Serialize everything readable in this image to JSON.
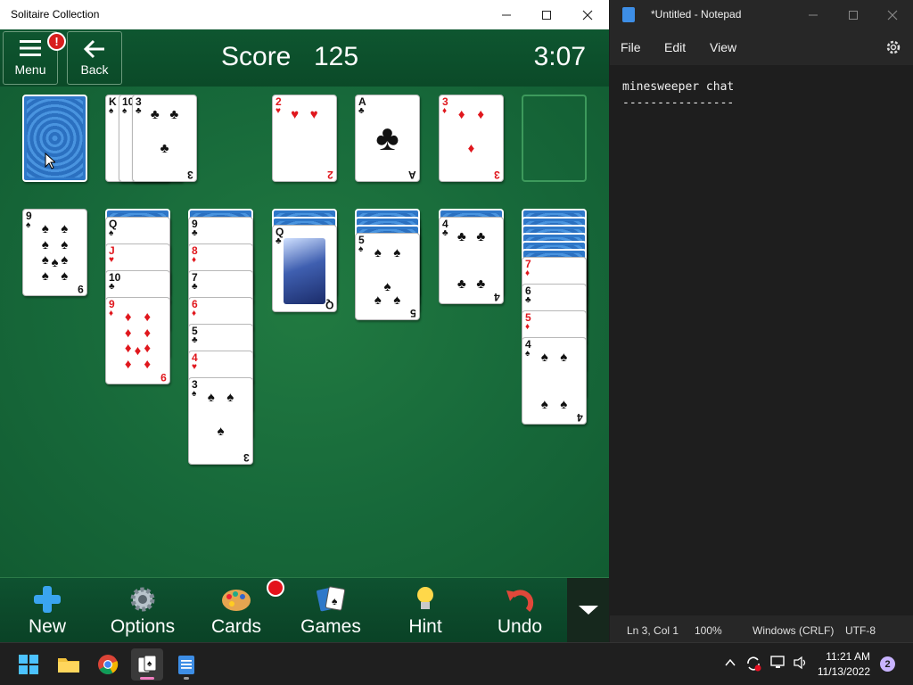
{
  "solitaire": {
    "title": "Solitaire Collection",
    "menu_label": "Menu",
    "menu_alert": "!",
    "back_label": "Back",
    "score_label": "Score",
    "score_value": "125",
    "timer": "3:07",
    "toolbar": {
      "new": "New",
      "options": "Options",
      "cards": "Cards",
      "games": "Games",
      "hint": "Hint",
      "undo": "Undo"
    },
    "waste": [
      {
        "rank": "K",
        "suit": "♠",
        "color": "black"
      },
      {
        "rank": "10",
        "suit": "♠",
        "color": "black"
      },
      {
        "rank": "3",
        "suit": "♣",
        "color": "black"
      }
    ],
    "foundations": [
      {
        "rank": "2",
        "suit": "♥",
        "color": "red"
      },
      {
        "rank": "A",
        "suit": "♣",
        "color": "black"
      },
      {
        "rank": "3",
        "suit": "♦",
        "color": "red"
      },
      null
    ],
    "tableau": [
      {
        "hidden": 0,
        "cards": [
          {
            "rank": "9",
            "suit": "♠",
            "color": "black"
          }
        ]
      },
      {
        "hidden": 1,
        "cards": [
          {
            "rank": "Q",
            "suit": "♠",
            "color": "black",
            "face": true
          },
          {
            "rank": "J",
            "suit": "♥",
            "color": "red",
            "face": true
          },
          {
            "rank": "10",
            "suit": "♣",
            "color": "black"
          },
          {
            "rank": "9",
            "suit": "♦",
            "color": "red"
          }
        ]
      },
      {
        "hidden": 1,
        "cards": [
          {
            "rank": "9",
            "suit": "♣",
            "color": "black"
          },
          {
            "rank": "8",
            "suit": "♦",
            "color": "red"
          },
          {
            "rank": "7",
            "suit": "♣",
            "color": "black"
          },
          {
            "rank": "6",
            "suit": "♦",
            "color": "red"
          },
          {
            "rank": "5",
            "suit": "♣",
            "color": "black"
          },
          {
            "rank": "4",
            "suit": "♥",
            "color": "red"
          },
          {
            "rank": "3",
            "suit": "♠",
            "color": "black"
          }
        ]
      },
      {
        "hidden": 2,
        "cards": [
          {
            "rank": "Q",
            "suit": "♣",
            "color": "black",
            "face": true
          }
        ]
      },
      {
        "hidden": 3,
        "cards": [
          {
            "rank": "5",
            "suit": "♠",
            "color": "black"
          }
        ]
      },
      {
        "hidden": 1,
        "cards": [
          {
            "rank": "4",
            "suit": "♣",
            "color": "black"
          }
        ]
      },
      {
        "hidden": 6,
        "cards": [
          {
            "rank": "7",
            "suit": "♦",
            "color": "red"
          },
          {
            "rank": "6",
            "suit": "♣",
            "color": "black"
          },
          {
            "rank": "5",
            "suit": "♦",
            "color": "red"
          },
          {
            "rank": "4",
            "suit": "♠",
            "color": "black"
          }
        ]
      }
    ]
  },
  "notepad": {
    "title": "*Untitled - Notepad",
    "menu": [
      "File",
      "Edit",
      "View"
    ],
    "lines": [
      "minesweeper chat",
      "----------------"
    ],
    "status": {
      "position": "Ln 3, Col 1",
      "zoom": "100%",
      "line_ending": "Windows (CRLF)",
      "encoding": "UTF-8"
    }
  },
  "taskbar": {
    "time": "11:21 AM",
    "date": "11/13/2022",
    "notifications": "2"
  },
  "colors": {
    "felt": "#17693a",
    "card_red": "#e0171d",
    "card_back": "#2f78c9"
  }
}
